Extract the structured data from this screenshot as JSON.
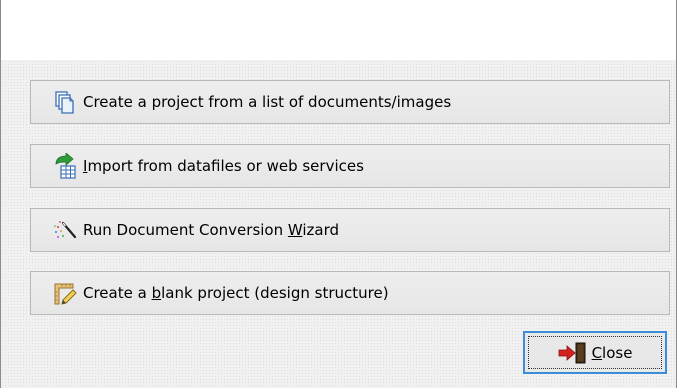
{
  "buttons": [
    {
      "id": "btn-1",
      "name": "create-from-documents-button",
      "icon": "copy-documents-icon",
      "pre": "Create a project from a list of documents/images",
      "accel": "",
      "post": ""
    },
    {
      "id": "btn-2",
      "name": "import-datafiles-button",
      "icon": "import-table-icon",
      "pre": "",
      "accel": "I",
      "post": "mport from datafiles or web services"
    },
    {
      "id": "btn-3",
      "name": "run-conversion-wizard-button",
      "icon": "magic-wand-icon",
      "pre": "Run Document Conversion ",
      "accel": "W",
      "post": "izard"
    },
    {
      "id": "btn-4",
      "name": "create-blank-project-button",
      "icon": "pencil-ruler-icon",
      "pre": "Create a ",
      "accel": "b",
      "post": "lank project (design structure)"
    }
  ],
  "close_button": {
    "icon": "exit-door-icon",
    "accel": "C",
    "post": "lose"
  },
  "colors": {
    "close_focus_border": "#3c8dd8",
    "exit_arrow": "#d42020"
  }
}
